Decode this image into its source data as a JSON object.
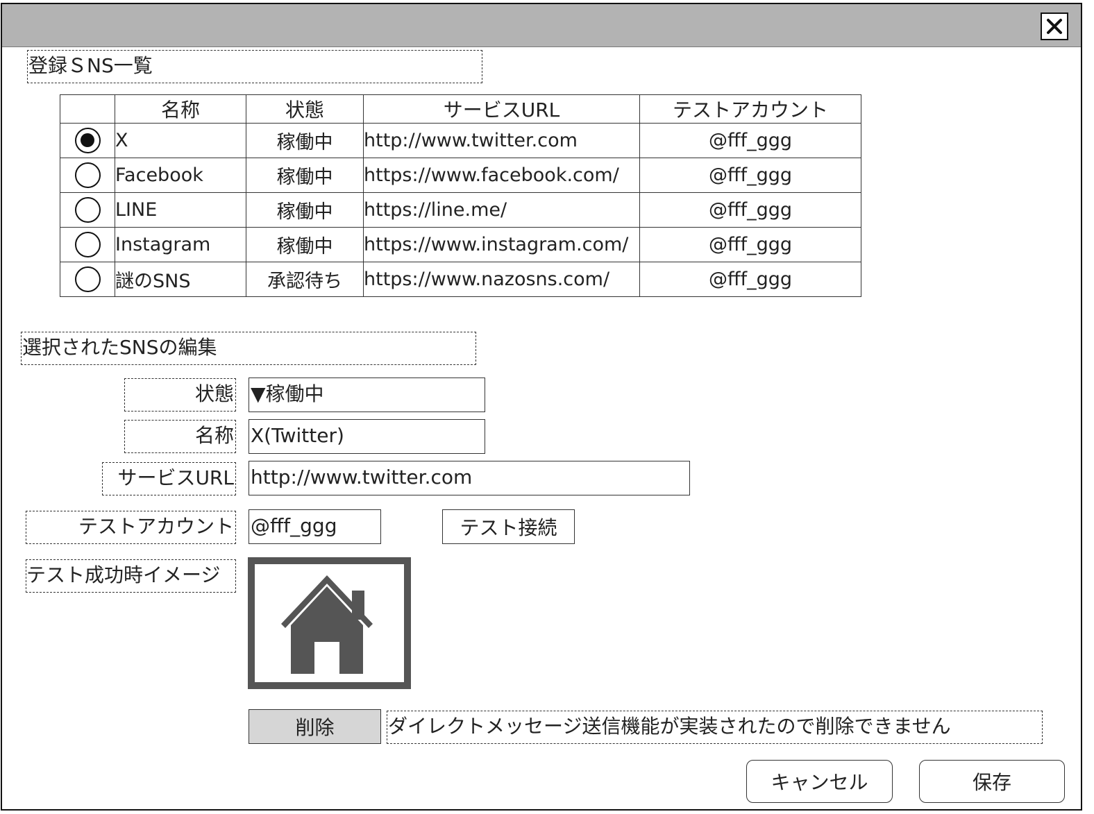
{
  "window": {
    "close_icon": "close-icon"
  },
  "registered": {
    "heading": "登録ＳNS一覧",
    "columns": [
      "",
      "名称",
      "状態",
      "サービスURL",
      "テストアカウント"
    ],
    "rows": [
      {
        "selected": true,
        "name": "X",
        "status": "稼働中",
        "url": "http://www.twitter.com",
        "account": "@fff_ggg"
      },
      {
        "selected": false,
        "name": "Facebook",
        "status": "稼働中",
        "url": "https://www.facebook.com/",
        "account": "@fff_ggg"
      },
      {
        "selected": false,
        "name": "LINE",
        "status": "稼働中",
        "url": "https://line.me/",
        "account": "@fff_ggg"
      },
      {
        "selected": false,
        "name": "Instagram",
        "status": "稼働中",
        "url": "https://www.instagram.com/",
        "account": "@fff_ggg"
      },
      {
        "selected": false,
        "name": "謎のSNS",
        "status": "承認待ち",
        "url": "https://www.nazosns.com/",
        "account": "@fff_ggg"
      }
    ]
  },
  "edit": {
    "heading": "選択されたSNSの編集",
    "status_label": "状態",
    "status_value": "▼稼働中",
    "name_label": "名称",
    "name_value": "X(Twitter)",
    "url_label": "サービスURL",
    "url_value": "http://www.twitter.com",
    "account_label": "テストアカウント",
    "account_value": "@fff_ggg",
    "test_button": "テスト接続",
    "image_label": "テスト成功時イメージ",
    "image_icon": "home-icon",
    "delete_button": "削除",
    "delete_note": "ダイレクトメッセージ送信機能が実装されたので削除できません"
  },
  "footer": {
    "cancel_button": "キャンセル",
    "save_button": "保存"
  },
  "colors": {
    "titlebar": "#b3b3b3",
    "disabled_button": "#d6d6d6",
    "icon": "#555555"
  }
}
